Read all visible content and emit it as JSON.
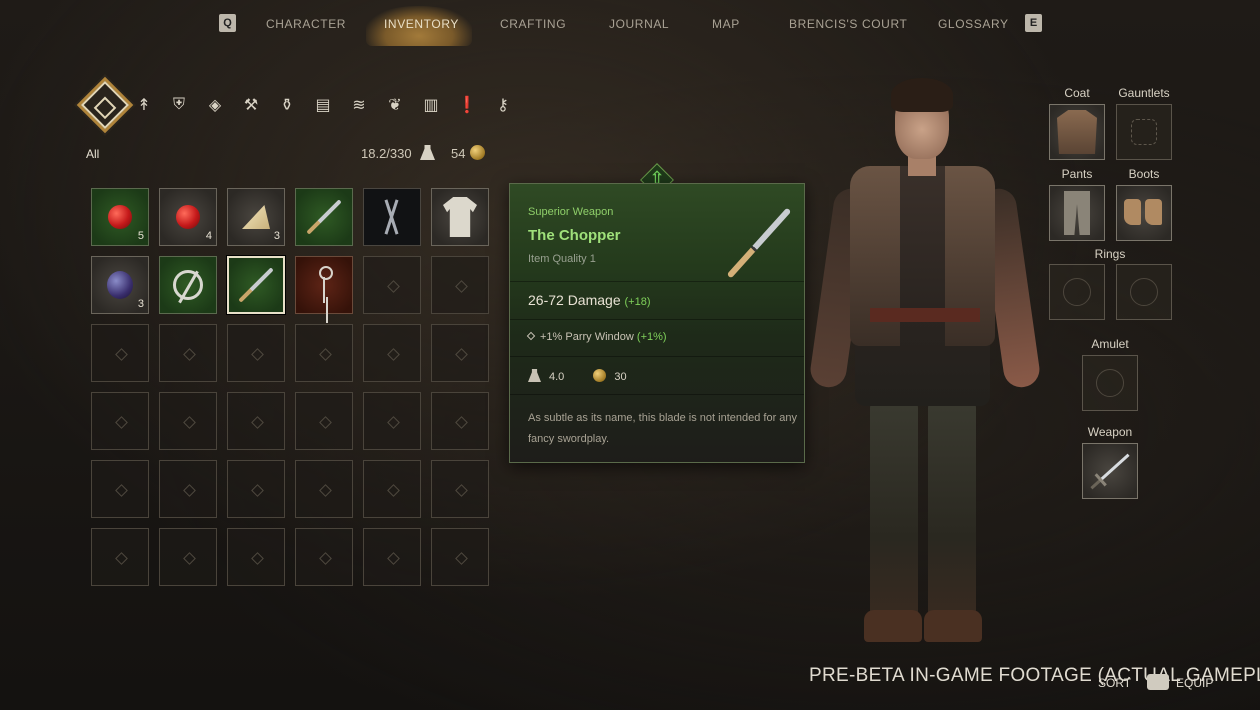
{
  "nav": {
    "key_left": "Q",
    "key_right": "E",
    "tabs": [
      "CHARACTER",
      "INVENTORY",
      "CRAFTING",
      "JOURNAL",
      "MAP",
      "BRENCIS'S COURT",
      "GLOSSARY"
    ],
    "active_tab": "INVENTORY"
  },
  "categories": {
    "icons": [
      "all-icon",
      "arrows-icon",
      "armor-icon",
      "helmet-icon",
      "crossed-tools-icon",
      "potion-icon",
      "book-icon",
      "scroll-icon",
      "herb-icon",
      "barrel-icon",
      "quest-icon",
      "key-icon"
    ],
    "selected": "all-icon"
  },
  "filter_label": "All",
  "weight": "18.2/330",
  "gold": "54",
  "inventory": {
    "slots": [
      {
        "item": "apple",
        "bg": "green",
        "count": "5"
      },
      {
        "item": "apple",
        "bg": "grey",
        "count": "4"
      },
      {
        "item": "cheese",
        "bg": "grey",
        "count": "3"
      },
      {
        "item": "dagger",
        "bg": "green",
        "count": ""
      },
      {
        "item": "nails",
        "bg": "dark",
        "count": ""
      },
      {
        "item": "linen-shirt",
        "bg": "grey",
        "count": ""
      },
      {
        "item": "plum",
        "bg": "grey",
        "count": "3"
      },
      {
        "item": "ring",
        "bg": "green",
        "count": ""
      },
      {
        "item": "the-chopper",
        "bg": "green",
        "count": "",
        "selected": true
      },
      {
        "item": "key",
        "bg": "red",
        "count": ""
      }
    ],
    "total_slots": 36
  },
  "tooltip": {
    "type": "Superior Weapon",
    "name": "The Chopper",
    "quality": "Item Quality 1",
    "damage": "26-72 Damage",
    "damage_bonus": "(+18)",
    "modifier_value": "+1%",
    "modifier_name": "Parry Window",
    "modifier_bonus": "(+1%)",
    "weight": "4.0",
    "price": "30",
    "description": "As subtle as its name, this blade is not intended for any fancy swordplay."
  },
  "equipment": {
    "coat": "Coat",
    "gauntlets": "Gauntlets",
    "pants": "Pants",
    "boots": "Boots",
    "rings": "Rings",
    "amulet": "Amulet",
    "weapon": "Weapon"
  },
  "footer": {
    "watermark": "PRE-BETA IN-GAME FOOTAGE (ACTUAL GAMEPLAY)",
    "sort": "SORT",
    "equip": "EQUIP"
  },
  "colors": {
    "accent_gold": "#b0843a",
    "rarity_green": "#9fe07a",
    "bonus_green": "#7fd05a"
  }
}
